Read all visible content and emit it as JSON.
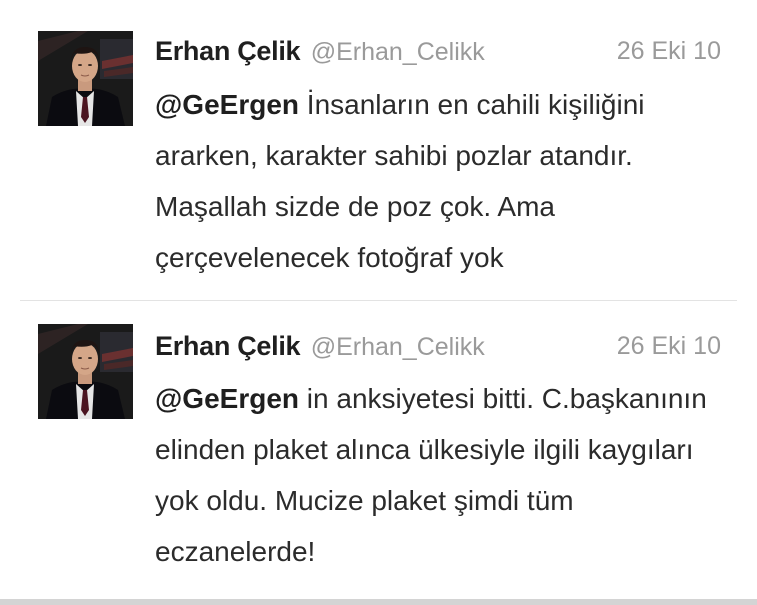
{
  "tweets": [
    {
      "author": {
        "display_name": "Erhan Çelik",
        "handle": "@Erhan_Celikk",
        "avatar_icon": "profile-photo-man-in-suit"
      },
      "timestamp": "26 Eki 10",
      "mention": "@GeErgen",
      "text": " İnsanların en cahili kişiliğini ararken, karakter sahibi pozlar atandır. Maşallah sizde de poz çok. Ama çerçevelenecek fotoğraf yok"
    },
    {
      "author": {
        "display_name": "Erhan Çelik",
        "handle": "@Erhan_Celikk",
        "avatar_icon": "profile-photo-man-in-suit"
      },
      "timestamp": "26 Eki 10",
      "mention": "@GeErgen",
      "text": " in anksiyetesi bitti. C.başkanının elinden plaket alınca ülkesiyle ilgili kaygıları yok oldu. Mucize plaket şimdi tüm eczanelerde!"
    }
  ],
  "colors": {
    "name": "#1f1f1f",
    "secondary": "#9a9a9a",
    "body_text": "#2b2b2b",
    "divider": "#e3e3e3"
  }
}
